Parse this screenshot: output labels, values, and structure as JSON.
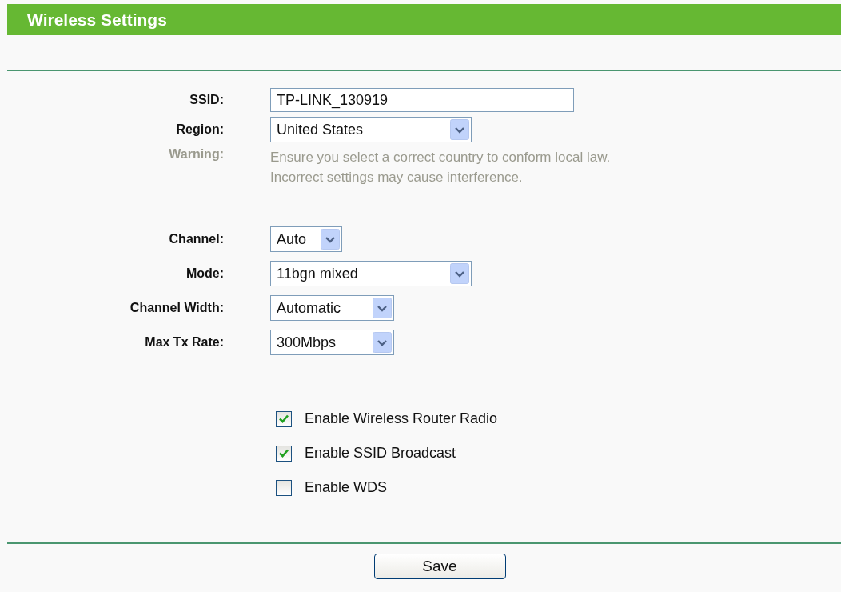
{
  "header": {
    "title": "Wireless Settings"
  },
  "fields": [
    {
      "kind": "text",
      "label": "SSID:",
      "value": "TP-LINK_130919"
    },
    {
      "kind": "select",
      "label": "Region:",
      "value": "United States"
    },
    {
      "kind": "note",
      "label": "Warning:",
      "lines": [
        "Ensure you select a correct country to conform local law.",
        "Incorrect settings may cause interference."
      ]
    }
  ],
  "radio_fields": [
    {
      "kind": "select",
      "label": "Channel:",
      "value": "Auto"
    },
    {
      "kind": "select",
      "label": "Mode:",
      "value": "11bgn mixed"
    },
    {
      "kind": "select",
      "label": "Channel Width:",
      "value": "Automatic"
    },
    {
      "kind": "select",
      "label": "Max Tx Rate:",
      "value": "300Mbps"
    }
  ],
  "options": [
    {
      "label": "Enable Wireless Router Radio",
      "checked": true
    },
    {
      "label": "Enable SSID Broadcast",
      "checked": true
    },
    {
      "label": "Enable WDS",
      "checked": false
    }
  ],
  "save_button": "Save"
}
